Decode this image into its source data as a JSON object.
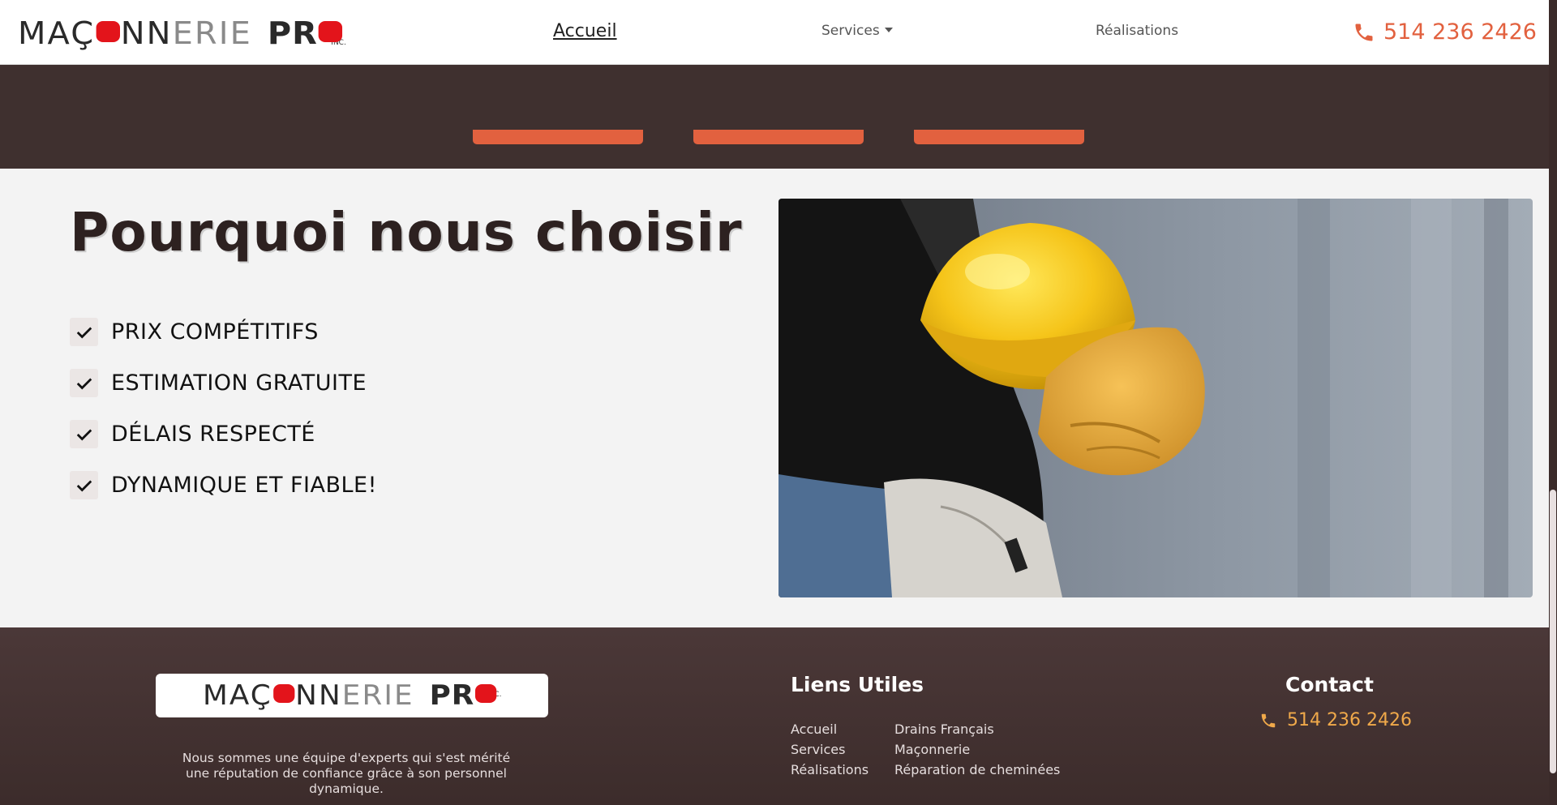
{
  "header": {
    "logo": {
      "word1": "MA",
      "word2": "Ç",
      "word3": "NN",
      "word4": "ERIE",
      "pro": "PR",
      "inc": "INC."
    },
    "nav": {
      "accueil": "Accueil",
      "services": "Services",
      "realisations": "Réalisations"
    },
    "phone": "514 236 2426"
  },
  "colors": {
    "accent": "#e2613f",
    "dark": "#3f302f",
    "gold": "#f0a94a",
    "logo_red": "#e3141b"
  },
  "why": {
    "title": "Pourquoi nous choisir",
    "items": [
      "PRIX COMPÉTITIFS",
      "ESTIMATION GRATUITE",
      "DÉLAIS RESPECTÉ",
      "DYNAMIQUE ET FIABLE!"
    ]
  },
  "footer": {
    "description": "Nous sommes une équipe d'experts qui s'est mérité une réputation de confiance grâce à son personnel dynamique.",
    "links_heading": "Liens Utiles",
    "links_col1": [
      "Accueil",
      "Services",
      "Réalisations"
    ],
    "links_col2": [
      "Drains Français",
      "Maçonnerie",
      "Réparation de cheminées"
    ],
    "contact_heading": "Contact",
    "phone": "514 236 2426"
  },
  "icons": [
    "phone-icon",
    "chevron-down-icon",
    "check-icon"
  ]
}
